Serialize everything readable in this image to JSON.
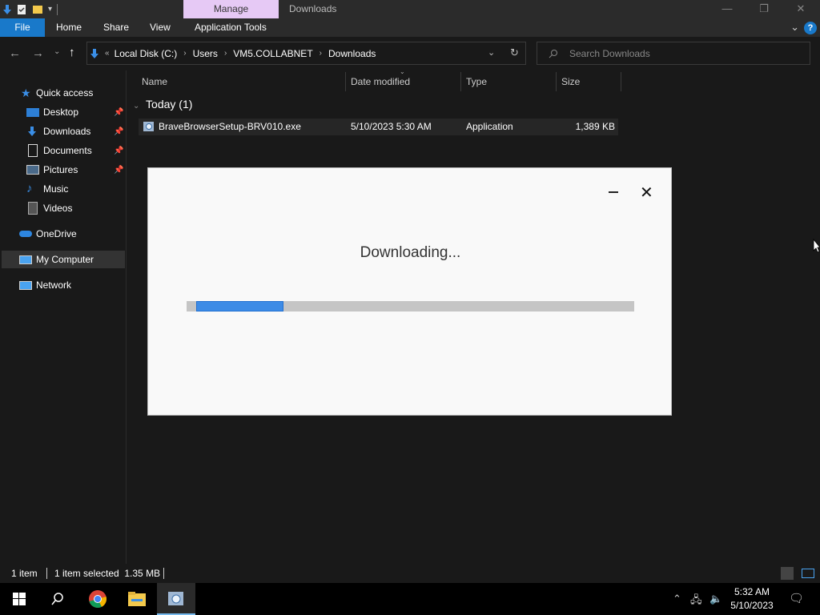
{
  "titlebar": {
    "context_tab": "Manage",
    "title": "Downloads",
    "minimize": "—",
    "restore": "❐",
    "close": "✕"
  },
  "ribbon": {
    "tabs": [
      "File",
      "Home",
      "Share",
      "View",
      "Application Tools"
    ],
    "help": "?"
  },
  "address": {
    "crumbs": [
      "Local Disk (C:)",
      "Users",
      "VM5.COLLABNET",
      "Downloads"
    ],
    "search_placeholder": "Search Downloads"
  },
  "nav": {
    "items": [
      {
        "label": "Quick access",
        "icon": "star-icon"
      },
      {
        "label": "Desktop",
        "icon": "desktop-icon",
        "pinned": true
      },
      {
        "label": "Downloads",
        "icon": "downloads-icon",
        "pinned": true
      },
      {
        "label": "Documents",
        "icon": "documents-icon",
        "pinned": true
      },
      {
        "label": "Pictures",
        "icon": "pictures-icon",
        "pinned": true
      },
      {
        "label": "Music",
        "icon": "music-icon"
      },
      {
        "label": "Videos",
        "icon": "videos-icon"
      },
      {
        "label": "OneDrive",
        "icon": "onedrive-icon"
      },
      {
        "label": "My Computer",
        "icon": "computer-icon",
        "selected": true
      },
      {
        "label": "Network",
        "icon": "network-icon"
      }
    ]
  },
  "columns": [
    "Name",
    "Date modified",
    "Type",
    "Size"
  ],
  "group": {
    "label": "Today (1)"
  },
  "files": [
    {
      "name": "BraveBrowserSetup-BRV010.exe",
      "date": "5/10/2023 5:30 AM",
      "type": "Application",
      "size": "1,389 KB"
    }
  ],
  "modal": {
    "title": "Downloading...",
    "progress": 0.2
  },
  "status": {
    "count": "1 item",
    "selected": "1 item selected  1.35 MB"
  },
  "taskbar": {
    "time": "5:32 AM",
    "date": "5/10/2023"
  },
  "colors": {
    "accent": "#1979ca",
    "manage_tab": "#e6c9f5",
    "progress": "#3d8be6"
  }
}
